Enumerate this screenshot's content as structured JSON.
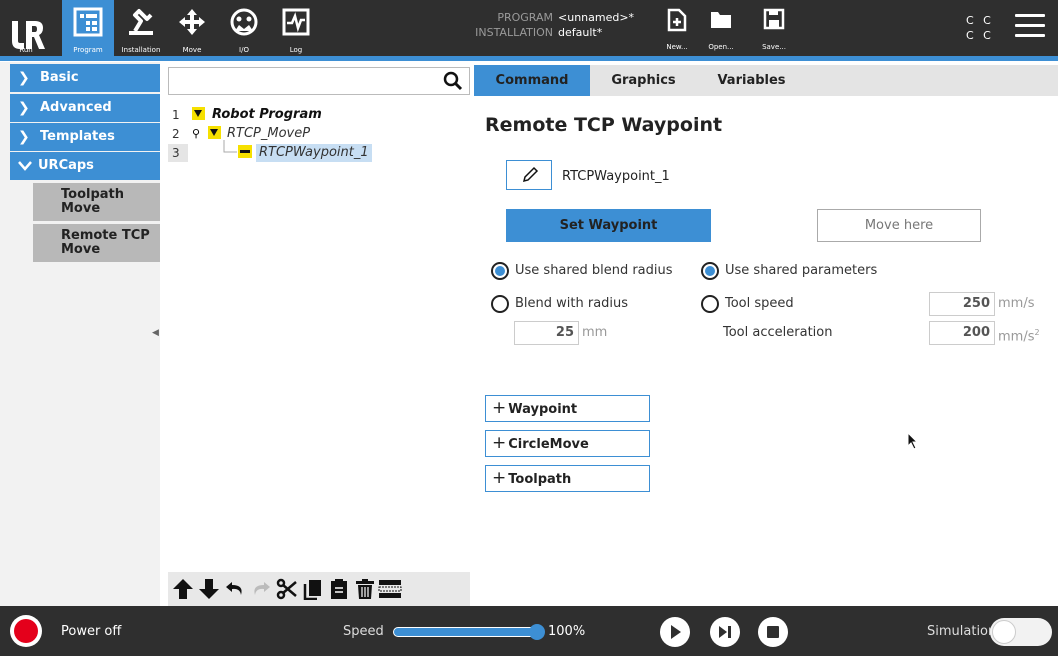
{
  "topbar": {
    "nav": [
      {
        "label": "Run",
        "icon": "run-logo-icon"
      },
      {
        "label": "Program",
        "icon": "program-icon"
      },
      {
        "label": "Installation",
        "icon": "installation-icon"
      },
      {
        "label": "Move",
        "icon": "move-icon"
      },
      {
        "label": "I/O",
        "icon": "io-icon"
      },
      {
        "label": "Log",
        "icon": "log-icon"
      }
    ],
    "program_key": "PROGRAM",
    "program_val": "<unnamed>*",
    "installation_key": "INSTALLATION",
    "installation_val": "default*",
    "new_label": "New...",
    "open_label": "Open...",
    "save_label": "Save...",
    "cc_top": "C C",
    "cc_bottom": "C C",
    "accent_color": "#3d8fd4"
  },
  "sidebar": {
    "items": [
      {
        "label": "Basic"
      },
      {
        "label": "Advanced"
      },
      {
        "label": "Templates"
      },
      {
        "label": "URCaps"
      }
    ],
    "urcaps_children": [
      {
        "label": "Toolpath Move"
      },
      {
        "label": "Remote TCP Move"
      }
    ]
  },
  "tree": {
    "rows": [
      {
        "num": "1",
        "text": "Robot Program"
      },
      {
        "num": "2",
        "text": "RTCP_MoveP"
      },
      {
        "num": "3",
        "text": "RTCPWaypoint_1"
      }
    ]
  },
  "panel": {
    "tabs": [
      "Command",
      "Graphics",
      "Variables"
    ],
    "title": "Remote TCP Waypoint",
    "waypoint_name": "RTCPWaypoint_1",
    "set_waypoint": "Set Waypoint",
    "move_here": "Move here",
    "use_shared_blend": "Use shared blend radius",
    "blend_with_radius": "Blend with radius",
    "blend_value": "25",
    "blend_unit": "mm",
    "use_shared_params": "Use shared parameters",
    "tool_speed": "Tool speed",
    "tool_speed_value": "250",
    "tool_speed_unit": "mm/s",
    "tool_accel": "Tool acceleration",
    "tool_accel_value": "200",
    "tool_accel_unit": "mm/s",
    "tool_accel_exp": "2",
    "add_buttons": [
      "Waypoint",
      "CircleMove",
      "Toolpath"
    ]
  },
  "bottombar": {
    "power": "Power off",
    "speed_label": "Speed",
    "speed_value": "100%",
    "speed_fraction": 1.0,
    "simulation": "Simulation",
    "power_color": "#e4001b"
  }
}
